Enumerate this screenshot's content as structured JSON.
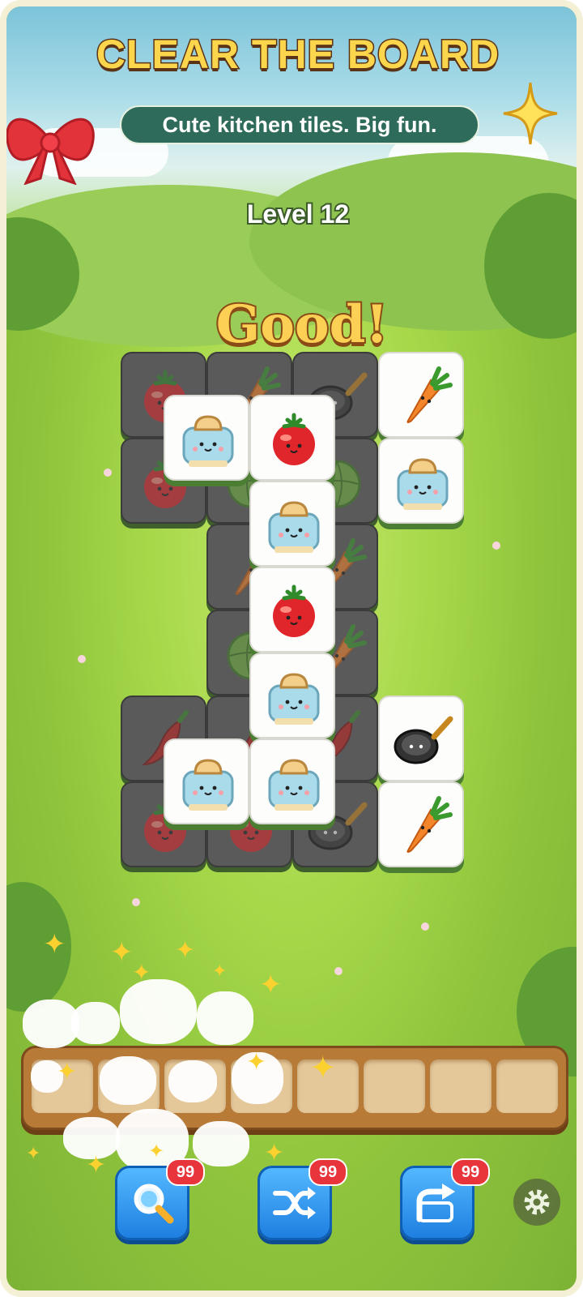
{
  "header": {
    "title": "CLEAR THE BOARD",
    "subtitle": "Cute kitchen tiles. Big fun."
  },
  "level_label": "Level 12",
  "feedback_text": "Good!",
  "colors": {
    "title_fill": "#fbd64d",
    "subtitle_bg": "#2f6b5a",
    "button_blue": "#1f7fe0",
    "badge_red": "#e8353b",
    "tray_wood": "#b77a37"
  },
  "board": {
    "tiles": [
      {
        "item": "tomato",
        "state": "blocked"
      },
      {
        "item": "carrot",
        "state": "blocked"
      },
      {
        "item": "frying-pan",
        "state": "blocked"
      },
      {
        "item": "carrot",
        "state": "free"
      },
      {
        "item": "tomato",
        "state": "blocked"
      },
      {
        "item": "cabbage",
        "state": "blocked"
      },
      {
        "item": "cabbage",
        "state": "blocked"
      },
      {
        "item": "toaster",
        "state": "free"
      },
      {
        "item": "toaster",
        "state": "free"
      },
      {
        "item": "tomato",
        "state": "free"
      },
      {
        "item": "carrot",
        "state": "blocked"
      },
      {
        "item": "carrot",
        "state": "blocked"
      },
      {
        "item": "toaster",
        "state": "free"
      },
      {
        "item": "cabbage",
        "state": "blocked"
      },
      {
        "item": "carrot",
        "state": "blocked"
      },
      {
        "item": "tomato",
        "state": "free"
      },
      {
        "item": "chili-pepper",
        "state": "blocked"
      },
      {
        "item": "chili-pepper",
        "state": "blocked"
      },
      {
        "item": "chili-pepper",
        "state": "blocked"
      },
      {
        "item": "frying-pan",
        "state": "free"
      },
      {
        "item": "toaster",
        "state": "free"
      },
      {
        "item": "tomato",
        "state": "blocked"
      },
      {
        "item": "tomato",
        "state": "blocked"
      },
      {
        "item": "frying-pan",
        "state": "blocked"
      },
      {
        "item": "carrot",
        "state": "free"
      },
      {
        "item": "toaster",
        "state": "free"
      },
      {
        "item": "toaster",
        "state": "free"
      }
    ]
  },
  "tray": {
    "slot_count": 8,
    "filled": 0
  },
  "powerups": [
    {
      "name": "hint",
      "icon": "magnifier-icon",
      "count": "99"
    },
    {
      "name": "shuffle",
      "icon": "shuffle-icon",
      "count": "99"
    },
    {
      "name": "undo",
      "icon": "undo-arrow-icon",
      "count": "99"
    }
  ],
  "settings_icon": "gear-icon"
}
